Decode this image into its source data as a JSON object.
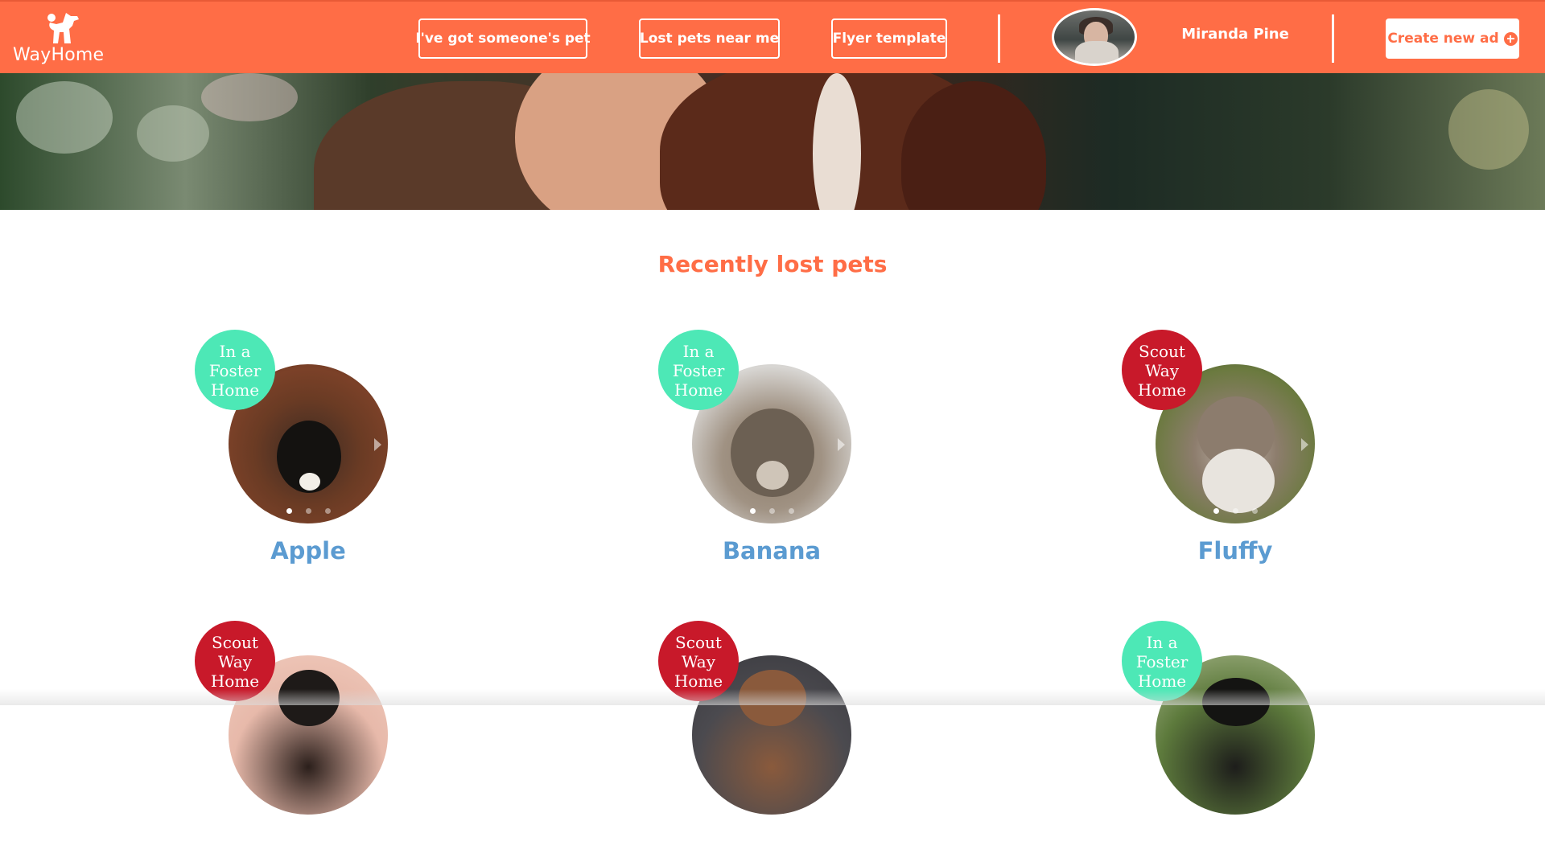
{
  "brand": {
    "logo_text": "WayHome",
    "color": "#ff6d46"
  },
  "nav": {
    "items": [
      {
        "label": "I've got someone's pet"
      },
      {
        "label": "Lost pets near me"
      },
      {
        "label": "Flyer template"
      }
    ]
  },
  "user": {
    "name": "Miranda Pine"
  },
  "actions": {
    "create_label": "Create new ad"
  },
  "main": {
    "section_title": "Recently lost pets",
    "pets": [
      {
        "name": "Apple",
        "status": "In a\nFoster\nHome",
        "status_color": "#4de8b6",
        "active_slide": 1,
        "slides": 3
      },
      {
        "name": "Banana",
        "status": "In a\nFoster\nHome",
        "status_color": "#4de8b6",
        "active_slide": 1,
        "slides": 3
      },
      {
        "name": "Fluffy",
        "status": "Scout\nWay\nHome",
        "status_color": "#c8192a",
        "active_slide": 1,
        "slides": 3
      },
      {
        "name": "",
        "status": "Scout\nWay\nHome",
        "status_color": "#c8192a"
      },
      {
        "name": "",
        "status": "Scout\nWay\nHome",
        "status_color": "#c8192a"
      },
      {
        "name": "",
        "status": "In a\nFoster\nHome",
        "status_color": "#4de8b6"
      }
    ]
  },
  "colors": {
    "accent": "#ff6d46",
    "name_blue": "#5b9bd1",
    "foster_green": "#4de8b6",
    "scout_red": "#c8192a"
  }
}
